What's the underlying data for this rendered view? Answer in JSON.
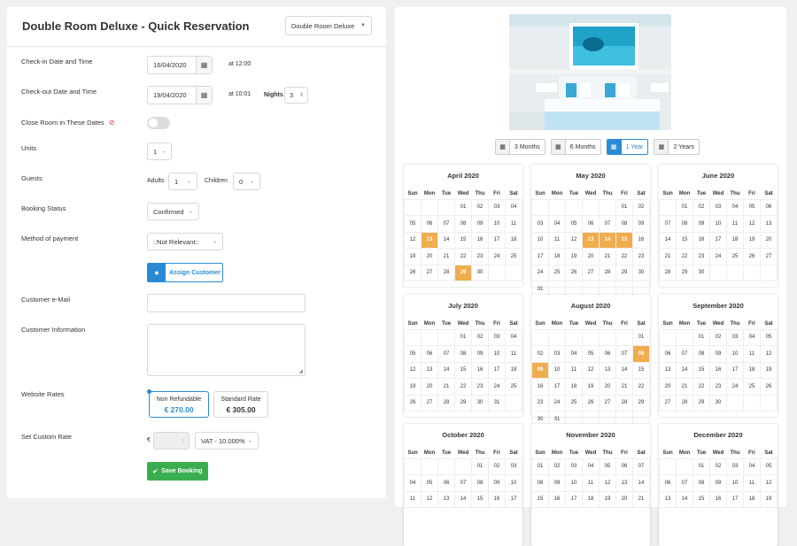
{
  "form": {
    "title": "Double Room Deluxe - Quick Reservation",
    "room_select": "Double Room Deluxe",
    "checkin_label": "Check-in Date and Time",
    "checkin_date": "16/04/2020",
    "checkin_time": "at 12:00",
    "checkout_label": "Check-out Date and Time",
    "checkout_date": "19/04/2020",
    "checkout_time": "at 10:01",
    "nights_label": "Nights",
    "nights_value": "3",
    "close_room_label": "Close Room in These Dates",
    "units_label": "Units",
    "units_value": "1",
    "guests_label": "Guests",
    "adults_label": "Adults",
    "adults_value": "1",
    "children_label": "Children",
    "children_value": "0",
    "status_label": "Booking Status",
    "status_value": "Confirmed",
    "payment_label": "Method of payment",
    "payment_value": "::Not Relevant::",
    "assign_label": "Assign Customer",
    "email_label": "Customer e-Mail",
    "info_label": "Customer Information",
    "rates_label": "Website Rates",
    "rate1_name": "Non Refundable",
    "rate1_price": "€ 270.00",
    "rate2_name": "Standard Rate",
    "rate2_price": "€ 305.00",
    "custom_rate_label": "Set Custom Rate",
    "currency": "€",
    "vat_value": "VAT - 10.000%",
    "save_label": "Save Booking"
  },
  "range": [
    "3 Months",
    "6 Months",
    "1 Year",
    "2 Years"
  ],
  "range_active": 2,
  "weekdays": [
    "Sun",
    "Mon",
    "Tue",
    "Wed",
    "Thu",
    "Fri",
    "Sat"
  ],
  "months": [
    {
      "name": "April 2020",
      "weeks": [
        [
          "",
          "",
          "",
          "01",
          "02",
          "03",
          "04"
        ],
        [
          "05",
          "06",
          "07",
          "08",
          "09",
          "10",
          "11"
        ],
        [
          "12",
          "13",
          "14",
          "15",
          "16",
          "17",
          "18"
        ],
        [
          "19",
          "20",
          "21",
          "22",
          "23",
          "24",
          "25"
        ],
        [
          "26",
          "27",
          "28",
          "29",
          "30",
          "",
          ""
        ]
      ],
      "booked": [
        "13",
        "29"
      ]
    },
    {
      "name": "May 2020",
      "weeks": [
        [
          "",
          "",
          "",
          "",
          "",
          "01",
          "02"
        ],
        [
          "03",
          "04",
          "05",
          "06",
          "07",
          "08",
          "09"
        ],
        [
          "10",
          "11",
          "12",
          "13",
          "14",
          "15",
          "16"
        ],
        [
          "17",
          "18",
          "19",
          "20",
          "21",
          "22",
          "23"
        ],
        [
          "24",
          "25",
          "26",
          "27",
          "28",
          "29",
          "30"
        ],
        [
          "31",
          "",
          "",
          "",
          "",
          "",
          ""
        ]
      ],
      "booked": [
        "13",
        "14",
        "15"
      ]
    },
    {
      "name": "June 2020",
      "weeks": [
        [
          "",
          "01",
          "02",
          "03",
          "04",
          "05",
          "06"
        ],
        [
          "07",
          "08",
          "09",
          "10",
          "11",
          "12",
          "13"
        ],
        [
          "14",
          "15",
          "16",
          "17",
          "18",
          "19",
          "20"
        ],
        [
          "21",
          "22",
          "23",
          "24",
          "25",
          "26",
          "27"
        ],
        [
          "28",
          "29",
          "30",
          "",
          "",
          "",
          ""
        ]
      ],
      "booked": []
    },
    {
      "name": "July 2020",
      "weeks": [
        [
          "",
          "",
          "",
          "01",
          "02",
          "03",
          "04"
        ],
        [
          "05",
          "06",
          "07",
          "08",
          "09",
          "10",
          "11"
        ],
        [
          "12",
          "13",
          "14",
          "15",
          "16",
          "17",
          "18"
        ],
        [
          "19",
          "20",
          "21",
          "22",
          "23",
          "24",
          "25"
        ],
        [
          "26",
          "27",
          "28",
          "29",
          "30",
          "31",
          ""
        ]
      ],
      "booked": []
    },
    {
      "name": "August 2020",
      "weeks": [
        [
          "",
          "",
          "",
          "",
          "",
          "",
          "01"
        ],
        [
          "02",
          "03",
          "04",
          "05",
          "06",
          "07",
          "08"
        ],
        [
          "09",
          "10",
          "11",
          "12",
          "13",
          "14",
          "15"
        ],
        [
          "16",
          "17",
          "18",
          "19",
          "20",
          "21",
          "22"
        ],
        [
          "23",
          "24",
          "25",
          "26",
          "27",
          "28",
          "29"
        ],
        [
          "30",
          "31",
          "",
          "",
          "",
          "",
          ""
        ]
      ],
      "booked": [
        "08",
        "09"
      ]
    },
    {
      "name": "September 2020",
      "weeks": [
        [
          "",
          "",
          "01",
          "02",
          "03",
          "04",
          "05"
        ],
        [
          "06",
          "07",
          "08",
          "09",
          "10",
          "11",
          "12"
        ],
        [
          "13",
          "14",
          "15",
          "16",
          "17",
          "18",
          "19"
        ],
        [
          "20",
          "21",
          "22",
          "23",
          "24",
          "25",
          "26"
        ],
        [
          "27",
          "28",
          "29",
          "30",
          "",
          "",
          ""
        ]
      ],
      "booked": []
    },
    {
      "name": "October 2020",
      "weeks": [
        [
          "",
          "",
          "",
          "",
          "01",
          "02",
          "03"
        ],
        [
          "04",
          "05",
          "06",
          "07",
          "08",
          "09",
          "10"
        ],
        [
          "11",
          "12",
          "13",
          "14",
          "15",
          "16",
          "17"
        ]
      ],
      "booked": []
    },
    {
      "name": "November 2020",
      "weeks": [
        [
          "01",
          "02",
          "03",
          "04",
          "05",
          "06",
          "07"
        ],
        [
          "08",
          "09",
          "10",
          "11",
          "12",
          "13",
          "14"
        ],
        [
          "15",
          "16",
          "17",
          "18",
          "19",
          "20",
          "21"
        ]
      ],
      "booked": []
    },
    {
      "name": "December 2020",
      "weeks": [
        [
          "",
          "",
          "01",
          "02",
          "03",
          "04",
          "05"
        ],
        [
          "06",
          "07",
          "08",
          "09",
          "10",
          "11",
          "12"
        ],
        [
          "13",
          "14",
          "15",
          "16",
          "17",
          "18",
          "19"
        ]
      ],
      "booked": []
    }
  ]
}
